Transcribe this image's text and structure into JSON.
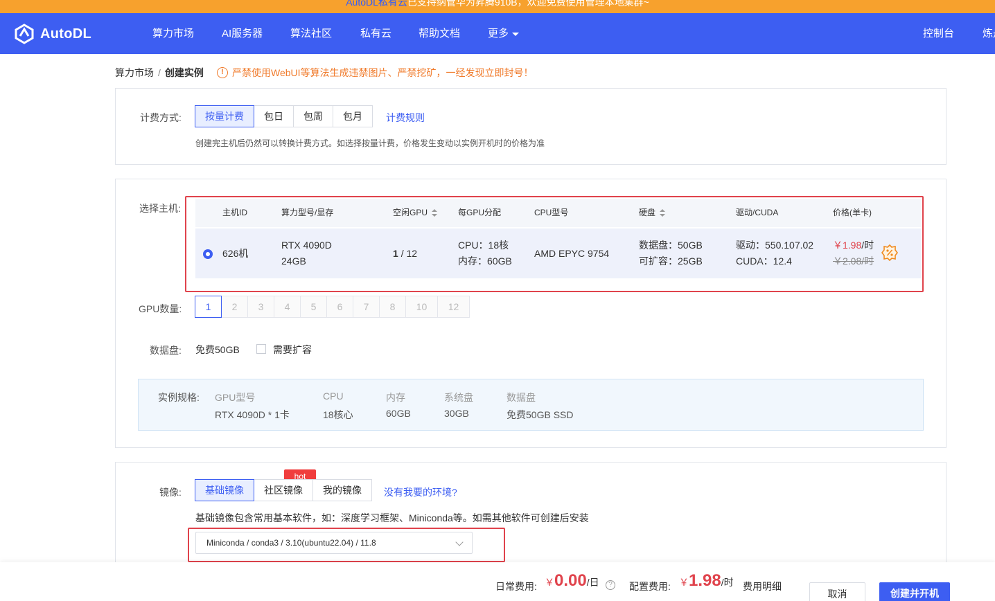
{
  "announcement": {
    "brand": "AutoDL私有云",
    "text": "已支持纳管华为昇腾910B，欢迎免费使用管理本地集群~"
  },
  "nav": {
    "logo_text": "AutoDL",
    "items": [
      {
        "label": "算力市场"
      },
      {
        "label": "AI服务器"
      },
      {
        "label": "算法社区"
      },
      {
        "label": "私有云"
      },
      {
        "label": "帮助文档"
      },
      {
        "label": "更多"
      }
    ],
    "console": "控制台",
    "user_partial": "炼丹"
  },
  "breadcrumb": {
    "parent": "算力市场",
    "sep": "/",
    "current": "创建实例"
  },
  "warning": {
    "icon": "!",
    "text": "严禁使用WebUI等算法生成违禁图片、严禁挖矿，一经发现立即封号！"
  },
  "billing": {
    "label": "计费方式:",
    "options": [
      {
        "label": "按量计费"
      },
      {
        "label": "包日"
      },
      {
        "label": "包周"
      },
      {
        "label": "包月"
      }
    ],
    "selected": "按量计费",
    "rules_link": "计费规则",
    "hint": "创建完主机后仍然可以转换计费方式。如选择按量计费，价格发生变动以实例开机时的价格为准"
  },
  "host": {
    "label": "选择主机:",
    "columns": [
      "主机ID",
      "算力型号/显存",
      "空闲GPU",
      "每GPU分配",
      "CPU型号",
      "硬盘",
      "驱动/CUDA",
      "价格(单卡)"
    ],
    "row": {
      "id": "626机",
      "gpu_model": "RTX 4090D",
      "gpu_mem": "24GB",
      "free_gpu": "1",
      "total_gpu": "/ 12",
      "cpu_alloc": "CPU：18核",
      "mem_alloc": "内存：60GB",
      "cpu_model": "AMD EPYC 9754",
      "disk_data": "数据盘：50GB",
      "disk_expand": "可扩容：25GB",
      "driver": "驱动：550.107.02",
      "cuda": "CUDA：12.4",
      "price": "￥1.98",
      "price_unit": "/时",
      "price_old": "￥2.08/时",
      "discount_icon": "discount-badge-icon"
    }
  },
  "gpu_count": {
    "label": "GPU数量:",
    "options": [
      "1",
      "2",
      "3",
      "4",
      "5",
      "6",
      "7",
      "8",
      "10",
      "12"
    ],
    "selected": "1"
  },
  "data_disk": {
    "label": "数据盘:",
    "free": "免费50GB",
    "expand_label": "需要扩容"
  },
  "spec": {
    "label": "实例规格:",
    "gpu": {
      "key": "GPU型号",
      "value": "RTX 4090D * 1卡"
    },
    "cpu": {
      "key": "CPU",
      "value": "18核心"
    },
    "mem": {
      "key": "内存",
      "value": "60GB"
    },
    "sys": {
      "key": "系统盘",
      "value": "30GB"
    },
    "data": {
      "key": "数据盘",
      "value": "免费50GB SSD"
    }
  },
  "image": {
    "label": "镜像:",
    "tabs": [
      {
        "label": "基础镜像"
      },
      {
        "label": "社区镜像"
      },
      {
        "label": "我的镜像"
      }
    ],
    "hot": "hot",
    "missing_link": "没有我要的环境?",
    "hint": "基础镜像包含常用基本软件，如：深度学习框架、Miniconda等。如需其他软件可创建后安装",
    "selected_value": "Miniconda / conda3 / 3.10(ubuntu22.04) / 11.8"
  },
  "footer": {
    "daily_label": "日常费用:",
    "daily_currency": "￥",
    "daily_amount": "0.00",
    "daily_unit": "/日",
    "config_label": "配置费用:",
    "config_currency": "￥",
    "config_amount": "1.98",
    "config_unit": "/时",
    "detail_link": "费用明细",
    "cancel": "取消",
    "create": "创建并开机"
  },
  "colors": {
    "primary": "#3d5ef2",
    "announce_bg": "#f7a12d",
    "warn": "#f07a2a",
    "danger": "#e0434c"
  }
}
